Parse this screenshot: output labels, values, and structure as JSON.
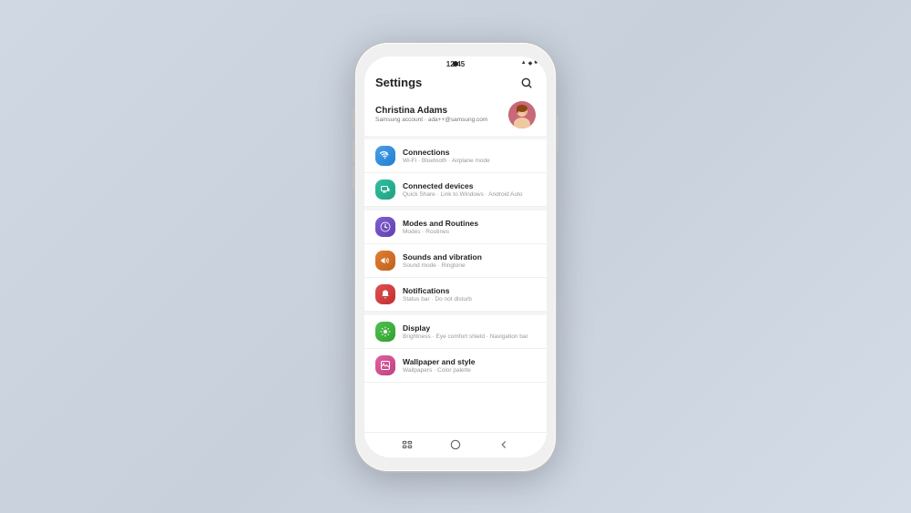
{
  "phone": {
    "status": {
      "time": "12:45",
      "icons": "▲ ◆ ■"
    },
    "header": {
      "title": "Settings",
      "search_label": "Search"
    },
    "profile": {
      "name": "Christina Adams",
      "account_label": "Samsung account",
      "email": "ada++@samsung.com"
    },
    "settings_items": [
      {
        "id": "connections",
        "title": "Connections",
        "subtitle": "Wi-Fi · Bluetooth · Airplane mode",
        "icon_color": "icon-blue"
      },
      {
        "id": "connected-devices",
        "title": "Connected devices",
        "subtitle": "Quick Share · Link to Windows · Android Auto",
        "icon_color": "icon-teal"
      },
      {
        "id": "modes-routines",
        "title": "Modes and Routines",
        "subtitle": "Modes · Routines",
        "icon_color": "icon-purple"
      },
      {
        "id": "sounds-vibration",
        "title": "Sounds and vibration",
        "subtitle": "Sound mode · Ringtone",
        "icon_color": "icon-orange"
      },
      {
        "id": "notifications",
        "title": "Notifications",
        "subtitle": "Status bar · Do not disturb",
        "icon_color": "icon-red"
      },
      {
        "id": "display",
        "title": "Display",
        "subtitle": "Brightness · Eye comfort shield · Navigation bar",
        "icon_color": "icon-green"
      },
      {
        "id": "wallpaper-style",
        "title": "Wallpaper and style",
        "subtitle": "Wallpapers · Color palette",
        "icon_color": "icon-pink"
      }
    ],
    "nav": {
      "back_label": "Back",
      "home_label": "Home",
      "recents_label": "Recents"
    }
  }
}
